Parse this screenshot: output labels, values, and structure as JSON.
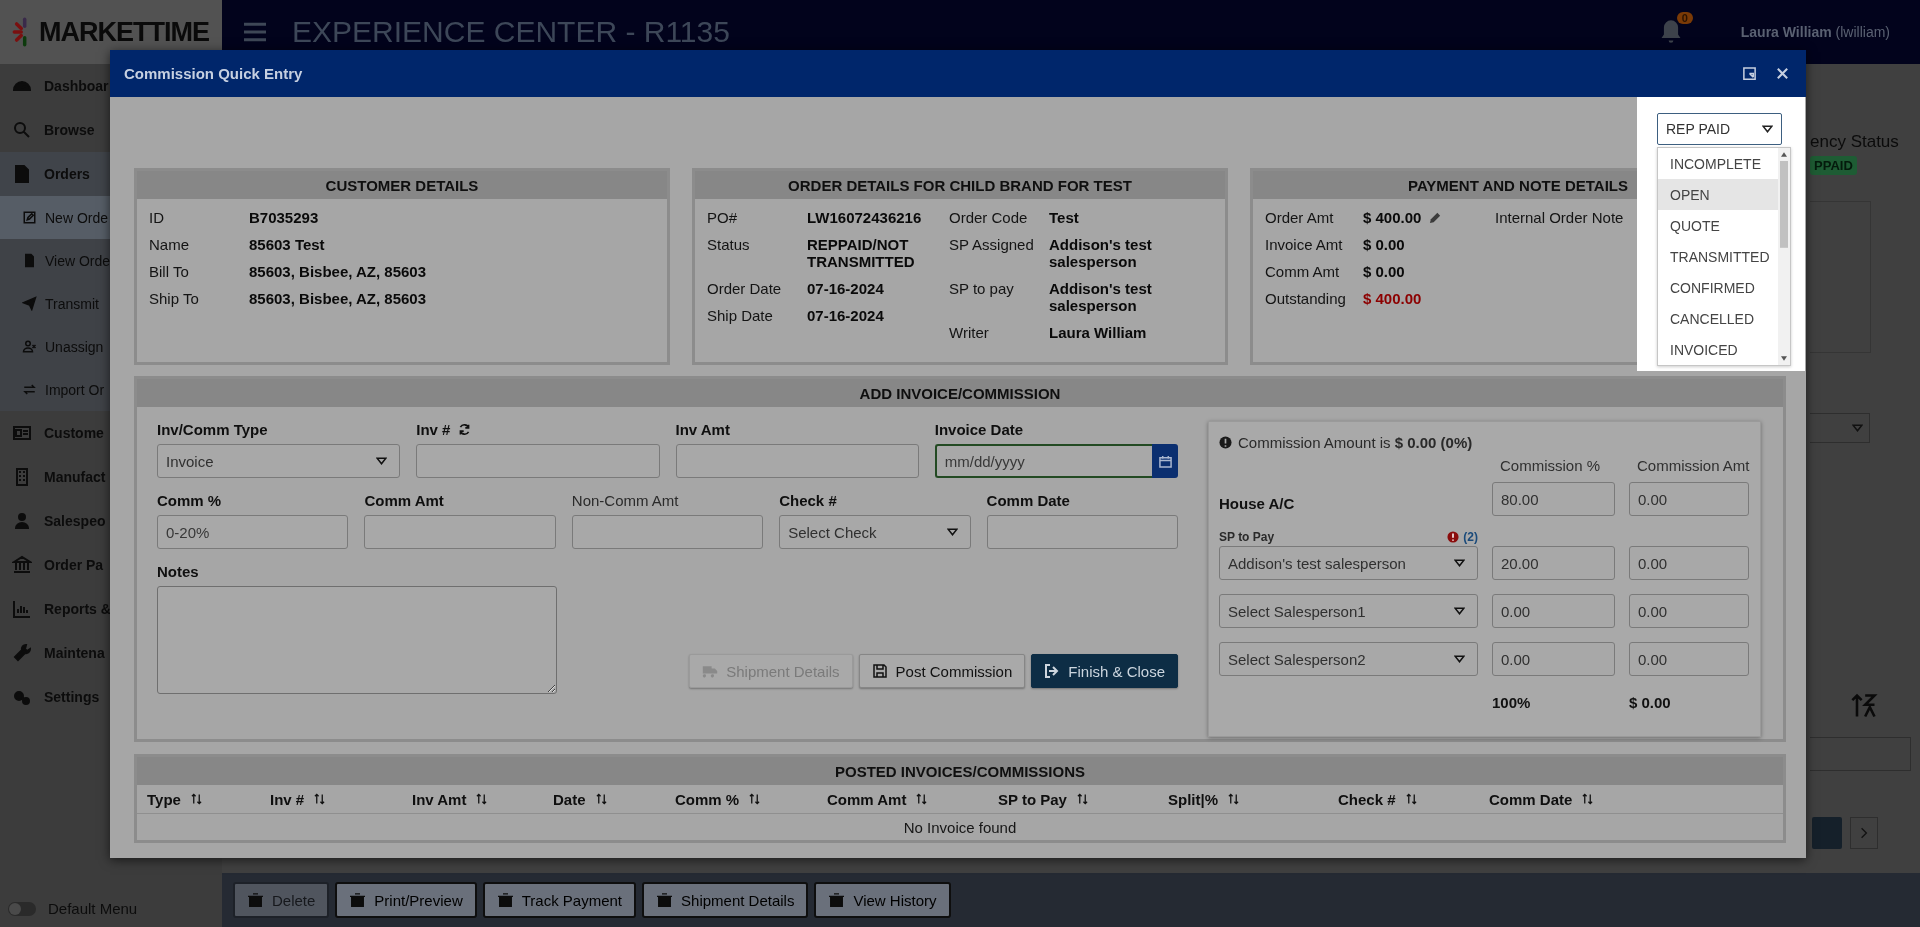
{
  "header": {
    "logo": "MARKETTIME",
    "title": "EXPERIENCE CENTER - R1135",
    "notification_count": "0",
    "user_name": "Laura William",
    "user_login": "(lwilliam)"
  },
  "sidebar": {
    "items": [
      {
        "label": "Dashboar",
        "selected": false
      },
      {
        "label": "Browse",
        "selected": false
      },
      {
        "label": "Orders",
        "selected": false,
        "expanded": true,
        "children": [
          {
            "label": "New Orde",
            "selected": true
          },
          {
            "label": "View Orde",
            "selected": false
          },
          {
            "label": "Transmit",
            "selected": false
          },
          {
            "label": "Unassign",
            "selected": false
          },
          {
            "label": "Import Or",
            "selected": false
          }
        ]
      },
      {
        "label": "Custome",
        "selected": false
      },
      {
        "label": "Manufact",
        "selected": false
      },
      {
        "label": "Salespeo",
        "selected": false
      },
      {
        "label": "Order Pa",
        "selected": false
      },
      {
        "label": "Reports &",
        "selected": false
      },
      {
        "label": "Maintena",
        "selected": false
      },
      {
        "label": "Settings",
        "selected": false
      }
    ],
    "default_menu": {
      "label": "Default Menu",
      "on": false
    }
  },
  "background": {
    "status_label": "ency Status",
    "status_badge": "PPAID",
    "toolbar": [
      {
        "label": "Delete",
        "disabled": true
      },
      {
        "label": "Print/Preview",
        "disabled": false
      },
      {
        "label": "Track Payment",
        "disabled": false
      },
      {
        "label": "Shipment Details",
        "disabled": false
      },
      {
        "label": "View History",
        "disabled": false
      }
    ]
  },
  "modal": {
    "title": "Commission Quick Entry",
    "status": {
      "value": "REP PAID",
      "expanded": true,
      "options": [
        {
          "label": "INCOMPLETE",
          "selected": false
        },
        {
          "label": "OPEN",
          "selected": true
        },
        {
          "label": "QUOTE",
          "selected": false
        },
        {
          "label": "TRANSMITTED",
          "selected": false
        },
        {
          "label": "CONFIRMED",
          "selected": false
        },
        {
          "label": "CANCELLED",
          "selected": false
        },
        {
          "label": "INVOICED",
          "selected": false
        }
      ]
    },
    "customer_details": {
      "title": "CUSTOMER DETAILS",
      "fields": [
        {
          "label": "ID",
          "value": "B7035293"
        },
        {
          "label": "Name",
          "value": "85603 Test"
        },
        {
          "label": "Bill To",
          "value": "85603, Bisbee, AZ, 85603"
        },
        {
          "label": "Ship To",
          "value": "85603, Bisbee, AZ, 85603"
        }
      ]
    },
    "order_details": {
      "title": "ORDER DETAILS FOR CHILD BRAND FOR TEST",
      "left_fields": [
        {
          "label": "PO#",
          "value": "LW16072436216"
        },
        {
          "label": "Status",
          "value": "REPPAID/NOT TRANSMITTED"
        },
        {
          "label": "Order Date",
          "value": "07-16-2024"
        },
        {
          "label": "Ship Date",
          "value": "07-16-2024"
        }
      ],
      "right_fields": [
        {
          "label": "Order Code",
          "value": "Test"
        },
        {
          "label": "SP Assigned",
          "value": "Addison's test salesperson"
        },
        {
          "label": "SP to pay",
          "value": "Addison's test salesperson"
        },
        {
          "label": "Writer",
          "value": "Laura William"
        }
      ]
    },
    "payment_details": {
      "title": "PAYMENT AND NOTE DETAILS",
      "note_label": "Internal Order Note",
      "fields": [
        {
          "label": "Order Amt",
          "value": "$ 400.00",
          "editable": true,
          "overdue": false
        },
        {
          "label": "Invoice Amt",
          "value": "$ 0.00",
          "editable": false,
          "overdue": false
        },
        {
          "label": "Comm Amt",
          "value": "$ 0.00",
          "editable": false,
          "overdue": false
        },
        {
          "label": "Outstanding",
          "value": "$ 400.00",
          "editable": false,
          "overdue": true
        }
      ]
    },
    "add_invoice": {
      "title": "ADD INVOICE/COMMISSION",
      "row_1": [
        {
          "label": "Inv/Comm Type",
          "kind": "select",
          "value": "Invoice",
          "required": true,
          "refresh": false
        },
        {
          "label": "Inv #",
          "kind": "input",
          "required": true,
          "refresh": true
        },
        {
          "label": "Inv Amt",
          "kind": "input",
          "required": true,
          "refresh": false
        },
        {
          "label": "Invoice Date",
          "kind": "date",
          "placeholder": "mm/dd/yyyy",
          "required": true,
          "refresh": false
        }
      ],
      "row_2": [
        {
          "label": "Comm %",
          "kind": "input",
          "placeholder": "0-20%",
          "required": true,
          "refresh": false
        },
        {
          "label": "Comm Amt",
          "kind": "input",
          "required": true,
          "refresh": false
        },
        {
          "label": "Non-Comm Amt",
          "kind": "input",
          "required": false,
          "refresh": false
        },
        {
          "label": "Check #",
          "kind": "select",
          "value": "Select Check",
          "required": true,
          "refresh": false
        },
        {
          "label": "Comm Date",
          "kind": "input",
          "required": true,
          "refresh": false
        }
      ],
      "notes_label": "Notes",
      "buttons": [
        {
          "label": "Shipment Details",
          "kind": "shipment",
          "disabled": true
        },
        {
          "label": "Post Commission",
          "kind": "save",
          "disabled": false
        },
        {
          "label": "Finish & Close",
          "kind": "finish",
          "disabled": false
        }
      ]
    },
    "commission": {
      "note": "Commission Amount is **$ 0.00 (0%)**",
      "columns": [
        "Commission %",
        "Commission Amt"
      ],
      "house": {
        "label": "House A/C",
        "percent": "80.00",
        "amount": "0.00"
      },
      "sp_label": "SP to Pay",
      "sp_count": "(2)",
      "rows": [
        {
          "value": "Addison's test salesperson",
          "percent": "20.00",
          "amount": "0.00"
        },
        {
          "value": "Select Salesperson1",
          "percent": "0.00",
          "amount": "0.00"
        },
        {
          "value": "Select Salesperson2",
          "percent": "0.00",
          "amount": "0.00"
        }
      ],
      "total_percent": "100%",
      "total_amount": "$ 0.00"
    },
    "posted": {
      "title": "POSTED INVOICES/COMMISSIONS",
      "columns": [
        "Type",
        "Inv #",
        "Inv Amt",
        "Date",
        "Comm %",
        "Comm Amt",
        "SP to Pay",
        "Split|%",
        "Check #",
        "Comm Date"
      ],
      "empty": "No Invoice found"
    }
  }
}
